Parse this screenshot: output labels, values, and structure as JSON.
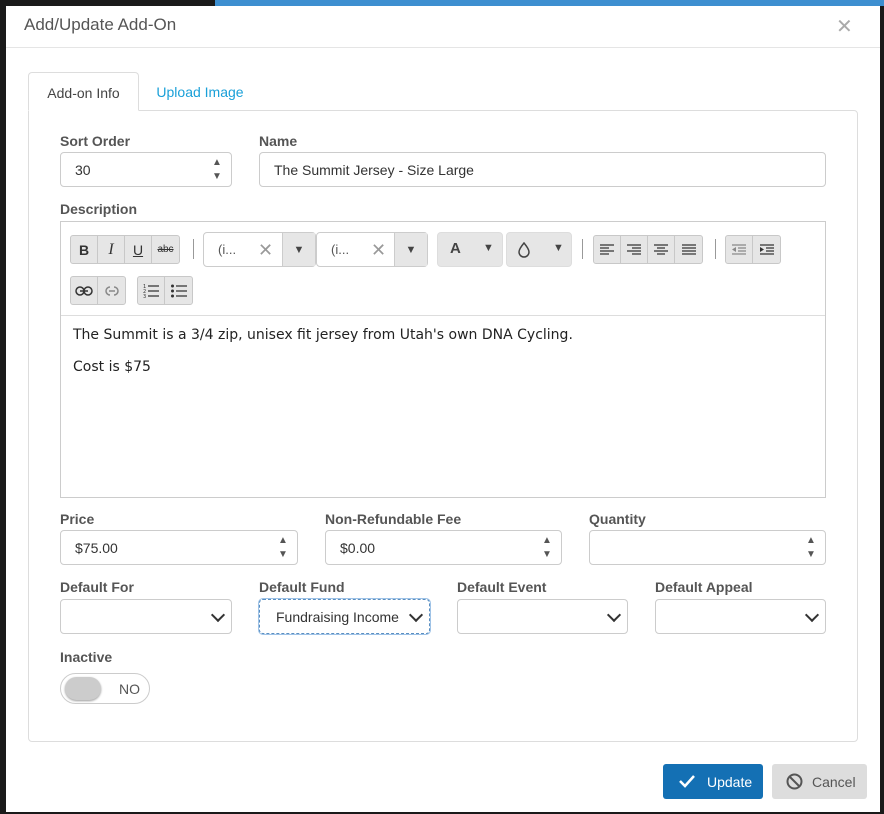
{
  "dialog": {
    "title": "Add/Update Add-On",
    "close_icon": "close-icon"
  },
  "tabs": [
    {
      "label": "Add-on Info"
    },
    {
      "label": "Upload Image"
    }
  ],
  "form": {
    "sort_order": {
      "label": "Sort Order",
      "value": "30"
    },
    "name": {
      "label": "Name",
      "value": "The Summit Jersey - Size Large"
    },
    "description": {
      "label": "Description",
      "toolbar": {
        "bold": "B",
        "italic": "I",
        "underline": "U",
        "strike": "abc",
        "font_family": "(i...",
        "font_size": "(i...",
        "font_color": "A"
      },
      "content": [
        "The Summit is a 3/4 zip, unisex fit jersey from Utah's own DNA Cycling.",
        "Cost is $75"
      ]
    },
    "price": {
      "label": "Price",
      "value": "$75.00"
    },
    "fee": {
      "label": "Non-Refundable Fee",
      "value": "$0.00"
    },
    "quantity": {
      "label": "Quantity",
      "value": ""
    },
    "default_for": {
      "label": "Default For",
      "value": ""
    },
    "default_fund": {
      "label": "Default Fund",
      "value": "Fundraising Income"
    },
    "default_event": {
      "label": "Default Event",
      "value": ""
    },
    "default_appeal": {
      "label": "Default Appeal",
      "value": ""
    },
    "inactive": {
      "label": "Inactive",
      "value": "NO"
    }
  },
  "footer": {
    "update_label": "Update",
    "cancel_label": "Cancel"
  },
  "colors": {
    "primary": "#1470b4",
    "link": "#1aa0d8"
  }
}
